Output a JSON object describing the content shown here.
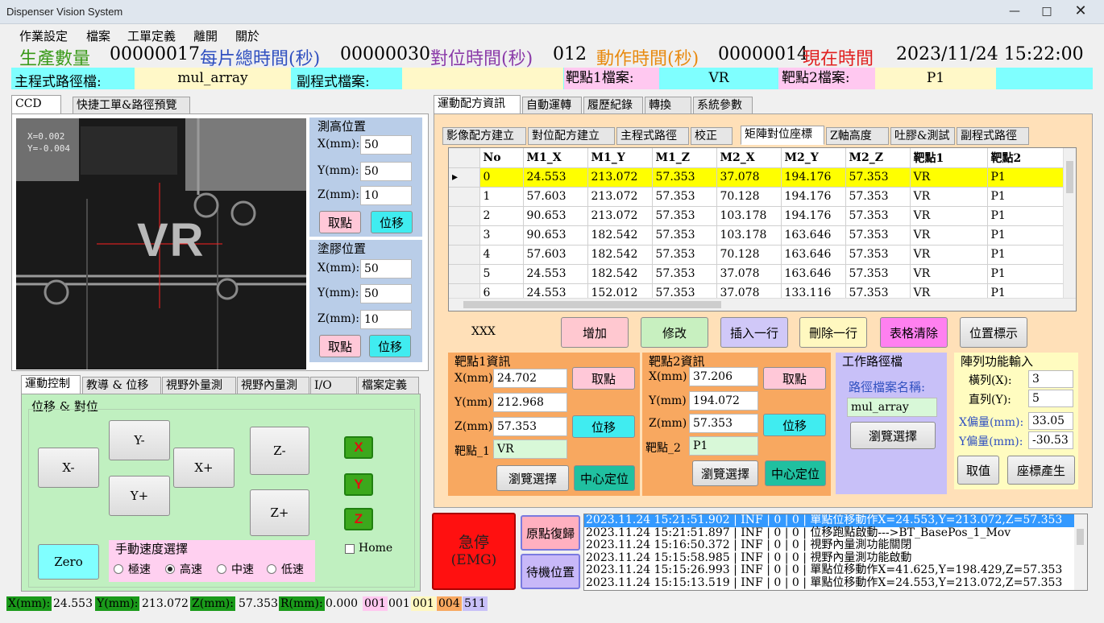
{
  "window": {
    "title": "Dispenser Vision System"
  },
  "menu": [
    "作業設定",
    "檔案",
    "工單定義",
    "離開",
    "關於"
  ],
  "status": {
    "prod_label": "生產數量",
    "prod_value": "00000017",
    "total_label": "每片總時間(秒)",
    "total_value": "00000030",
    "align_label": "對位時間(秒)",
    "align_value": "012",
    "action_label": "動作時間(秒)",
    "action_value": "00000014",
    "now_label": "現在時間",
    "now_value": "2023/11/24  15:22:00",
    "colors": {
      "prod": "#3a9a1a",
      "total": "#3050c0",
      "align": "#8a3aa8",
      "action": "#e88a10",
      "now": "#e02020"
    }
  },
  "files": {
    "main_label": "主程式路徑檔:",
    "main_value": "mul_array",
    "sub_label": "副程式檔案:",
    "sub_value": "",
    "t1_label": "靶點1檔案:",
    "t1_value": "VR",
    "t2_label": "靶點2檔案:",
    "t2_value": "P1"
  },
  "left_tabs": [
    "CCD",
    "快捷工單&路徑預覽"
  ],
  "camera": {
    "coord_x": "X=0.002",
    "coord_y": "Y=-0.004",
    "mark_text": "VR"
  },
  "measure": {
    "title": "測高位置",
    "x_label": "X(mm):",
    "x": "50",
    "y_label": "Y(mm):",
    "y": "50",
    "z_label": "Z(mm):",
    "z": "10",
    "take": "取點",
    "move": "位移"
  },
  "glue": {
    "title": "塗膠位置",
    "x_label": "X(mm):",
    "x": "50",
    "y_label": "Y(mm):",
    "y": "50",
    "z_label": "Z(mm):",
    "z": "10",
    "take": "取點",
    "move": "位移"
  },
  "motion_tabs": [
    "運動控制",
    "教導 & 位移",
    "視野外量測",
    "視野內量測",
    "I/O",
    "檔案定義"
  ],
  "motion": {
    "group": "位移 &  對位",
    "xm": "X-",
    "xp": "X+",
    "ym": "Y-",
    "yp": "Y+",
    "zm": "Z-",
    "zp": "Z+",
    "zero": "Zero",
    "ax": "X",
    "ay": "Y",
    "az": "Z",
    "home": "Home",
    "speed_title": "手動速度選擇",
    "speeds": [
      "極速",
      "高速",
      "中速",
      "低速"
    ],
    "speed_selected": "高速"
  },
  "right_tabs": [
    "運動配方資訊",
    "自動運轉",
    "履歷紀錄",
    "轉換",
    "系統參數"
  ],
  "sub_tabs": [
    "影像配方建立",
    "對位配方建立",
    "主程式路徑",
    "校正",
    "矩陣對位座標",
    "Z軸高度",
    "吐膠&測試",
    "副程式路徑"
  ],
  "table": {
    "headers": [
      "No",
      "M1_X",
      "M1_Y",
      "M1_Z",
      "M2_X",
      "M2_Y",
      "M2_Z",
      "靶點1",
      "靶點2"
    ],
    "rows": [
      [
        "0",
        "24.553",
        "213.072",
        "57.353",
        "37.078",
        "194.176",
        "57.353",
        "VR",
        "P1"
      ],
      [
        "1",
        "57.603",
        "213.072",
        "57.353",
        "70.128",
        "194.176",
        "57.353",
        "VR",
        "P1"
      ],
      [
        "2",
        "90.653",
        "213.072",
        "57.353",
        "103.178",
        "194.176",
        "57.353",
        "VR",
        "P1"
      ],
      [
        "3",
        "90.653",
        "182.542",
        "57.353",
        "103.178",
        "163.646",
        "57.353",
        "VR",
        "P1"
      ],
      [
        "4",
        "57.603",
        "182.542",
        "57.353",
        "70.128",
        "163.646",
        "57.353",
        "VR",
        "P1"
      ],
      [
        "5",
        "24.553",
        "182.542",
        "57.353",
        "37.078",
        "163.646",
        "57.353",
        "VR",
        "P1"
      ],
      [
        "6",
        "24.553",
        "152.012",
        "57.353",
        "37.078",
        "133.116",
        "57.353",
        "VR",
        "P1"
      ]
    ]
  },
  "actions": {
    "xxx": "XXX",
    "add": "增加",
    "modify": "修改",
    "insert": "插入一行",
    "delete": "刪除一行",
    "clear": "表格清除",
    "mark": "位置標示"
  },
  "t1info": {
    "title": "靶點1資訊",
    "x_label": "X(mm)",
    "x": "24.702",
    "y_label": "Y(mm)",
    "y": "212.968",
    "z_label": "Z(mm)",
    "z": "57.353",
    "name_label": "靶點_1",
    "name": "VR",
    "take": "取點",
    "move": "位移",
    "browse": "瀏覽選擇",
    "center": "中心定位"
  },
  "t2info": {
    "title": "靶點2資訊",
    "x_label": "X(mm)",
    "x": "37.206",
    "y_label": "Y(mm)",
    "y": "194.072",
    "z_label": "Z(mm)",
    "z": "57.353",
    "name_label": "靶點_2",
    "name": "P1",
    "take": "取點",
    "move": "位移",
    "browse": "瀏覽選擇",
    "center": "中心定位"
  },
  "workpath": {
    "title": "工作路徑檔",
    "label": "路徑檔案名稱:",
    "value": "mul_array",
    "browse": "瀏覽選擇"
  },
  "array": {
    "title": "陣列功能輸入",
    "cols_label": "橫列(X):",
    "cols": "3",
    "rows_label": "直列(Y):",
    "rows": "5",
    "xoff_label": "X偏量(mm):",
    "xoff": "33.05",
    "yoff_label": "Y偏量(mm):",
    "yoff": "-30.53",
    "take": "取值",
    "gen": "座標產生"
  },
  "controls": {
    "emg_line1": "急停",
    "emg_line2": "(EMG)",
    "home": "原點復歸",
    "standby": "待機位置"
  },
  "log": [
    "2023.11.24 15:21:51.902 | INF | 0 | 0 | 單點位移動作X=24.553,Y=213.072,Z=57.353",
    "2023.11.24 15:21:51.897 | INF | 0 | 0 | 位移跑點啟動--->BT_BasePos_1_Mov",
    "2023.11.24 15:16:50.372 | INF | 0 | 0 | 視野內量測功能關閉",
    "2023.11.24 15:15:58.985 | INF | 0 | 0 | 視野內量測功能啟動",
    "2023.11.24 15:15:26.993 | INF | 0 | 0 | 單點位移動作X=41.625,Y=198.429,Z=57.353",
    "2023.11.24 15:15:13.519 | INF | 0 | 0 | 單點位移動作X=24.553,Y=213.072,Z=57.353"
  ],
  "bottom": {
    "x_label": "X(mm):",
    "x": "24.553",
    "y_label": "Y(mm):",
    "y": "213.072",
    "z_label": "Z(mm):",
    "z": "57.353",
    "r_label": "R(mm):",
    "r": "0.000",
    "c1": "001",
    "c2": "001",
    "c3": "001",
    "c4": "004",
    "c5": "511"
  }
}
